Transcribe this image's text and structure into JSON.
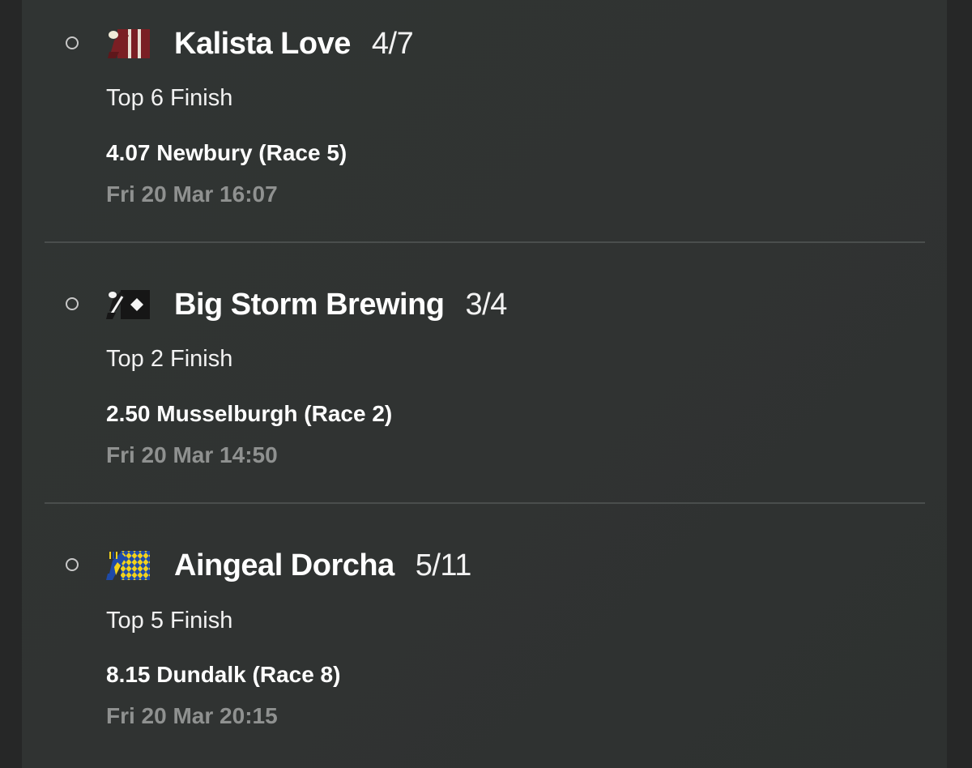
{
  "selections": [
    {
      "silk_icon": "jockey-silks-maroon-stripes-icon",
      "horse": "Kalista Love",
      "odds": "4/7",
      "market": "Top 6 Finish",
      "race": "4.07 Newbury (Race 5)",
      "datetime": "Fri 20 Mar 16:07"
    },
    {
      "silk_icon": "jockey-silks-black-white-diamond-icon",
      "horse": "Big Storm Brewing",
      "odds": "3/4",
      "market": "Top 2 Finish",
      "race": "2.50 Musselburgh (Race 2)",
      "datetime": "Fri 20 Mar 14:50"
    },
    {
      "silk_icon": "jockey-silks-yellow-blue-diamonds-icon",
      "horse": "Aingeal Dorcha",
      "odds": "5/11",
      "market": "Top 5 Finish",
      "race": "8.15 Dundalk (Race 8)",
      "datetime": "Fri 20 Mar 20:15"
    }
  ],
  "colors": {
    "background": "#262727",
    "panel": "#303433",
    "text_primary": "#ffffff",
    "text_muted": "#8f9190",
    "divider": "#4a4e4d"
  }
}
